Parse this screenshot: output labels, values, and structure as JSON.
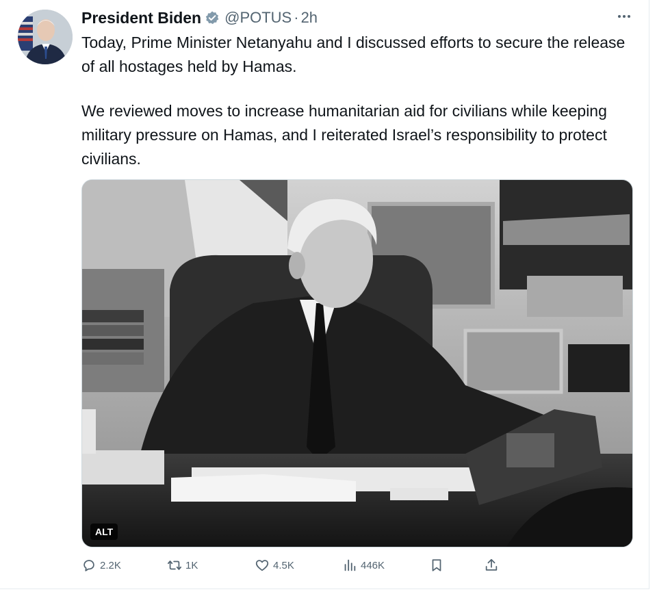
{
  "author": {
    "name": "President Biden",
    "handle": "@POTUS",
    "separator": "·",
    "time": "2h",
    "verified_color": "#829aab"
  },
  "tweet": {
    "paragraphs": [
      "Today, Prime Minister Netanyahu and I discussed efforts to secure the release of all hostages held by Hamas.",
      "We reviewed moves to increase humanitarian aid for civilians while keeping military pressure on Hamas, and I reiterated Israel’s responsibility to protect civilians."
    ]
  },
  "media": {
    "alt_label": "ALT"
  },
  "actions": {
    "replies": "2.2K",
    "reposts": "1K",
    "likes": "4.5K",
    "views": "446K"
  },
  "colors": {
    "text": "#0f1419",
    "muted": "#536471",
    "border": "#cfd9de"
  },
  "icons": [
    "verified-badge-icon",
    "more-icon",
    "reply-icon",
    "repost-icon",
    "like-icon",
    "views-icon",
    "bookmark-icon",
    "share-icon"
  ]
}
